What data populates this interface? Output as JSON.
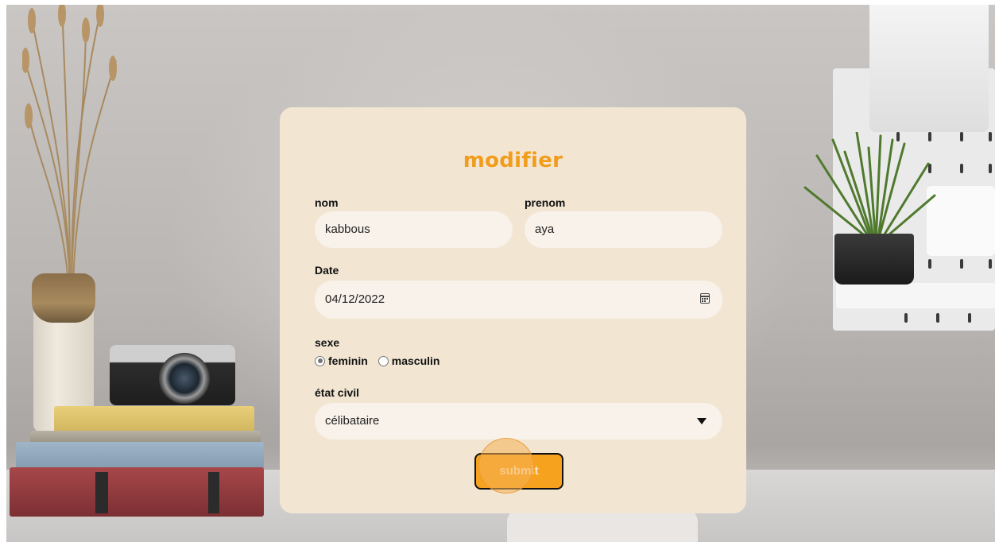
{
  "form": {
    "title": "modifier",
    "nom": {
      "label": "nom",
      "value": "kabbous"
    },
    "prenom": {
      "label": "prenom",
      "value": "aya"
    },
    "date": {
      "label": "Date",
      "value": "04/12/2022",
      "icon": "calendar-icon"
    },
    "sexe": {
      "label": "sexe",
      "options": [
        {
          "label": "feminin",
          "checked": true
        },
        {
          "label": "masculin",
          "checked": false
        }
      ]
    },
    "etat_civil": {
      "label": "état civil",
      "value": "célibataire",
      "icon": "chevron-down-icon"
    },
    "submit_label": "submit"
  },
  "colors": {
    "accent": "#f29c1c",
    "card": "#f2e6d3",
    "field": "#f8f2ea",
    "button": "#f7a21e"
  }
}
